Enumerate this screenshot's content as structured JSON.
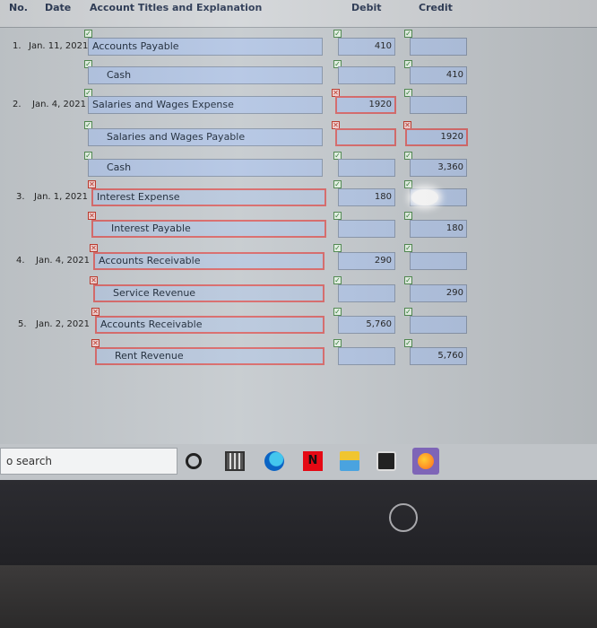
{
  "header": {
    "no": "No.",
    "date": "Date",
    "account": "Account Titles and Explanation",
    "debit": "Debit",
    "credit": "Credit"
  },
  "entries": [
    {
      "num": "1.",
      "date": "Jan. 11, 2021",
      "lines": [
        {
          "account": "Accounts Payable",
          "debit": "410",
          "credit": ""
        },
        {
          "account": "Cash",
          "debit": "",
          "credit": "410"
        }
      ]
    },
    {
      "num": "2.",
      "date": "Jan. 4, 2021",
      "lines": [
        {
          "account": "Salaries and Wages Expense",
          "debit": "1920",
          "credit": ""
        },
        {
          "account": "Salaries and Wages Payable",
          "debit": "",
          "credit": "1920"
        },
        {
          "account": "Cash",
          "debit": "",
          "credit": "3,360"
        }
      ]
    },
    {
      "num": "3.",
      "date": "Jan. 1, 2021",
      "lines": [
        {
          "account": "Interest Expense",
          "debit": "180",
          "credit": ""
        },
        {
          "account": "Interest Payable",
          "debit": "",
          "credit": "180"
        }
      ]
    },
    {
      "num": "4.",
      "date": "Jan. 4, 2021",
      "lines": [
        {
          "account": "Accounts Receivable",
          "debit": "290",
          "credit": ""
        },
        {
          "account": "Service Revenue",
          "debit": "",
          "credit": "290"
        }
      ]
    },
    {
      "num": "5.",
      "date": "Jan. 2, 2021",
      "lines": [
        {
          "account": "Accounts Receivable",
          "debit": "5,760",
          "credit": ""
        },
        {
          "account": "Rent Revenue",
          "debit": "",
          "credit": "5,760"
        }
      ]
    }
  ],
  "taskbar": {
    "search_text": "o search",
    "icons": [
      "cortana-circle-icon",
      "calculator-icon",
      "edge-browser-icon",
      "netflix-icon",
      "file-explorer-icon",
      "microsoft-store-icon",
      "firefox-icon"
    ]
  },
  "brand": "hp",
  "colors": {
    "field": "#b4c6e4",
    "wrong_border": "#d96b6b",
    "check": "#2e7d32",
    "x_mark": "#c0392b"
  }
}
